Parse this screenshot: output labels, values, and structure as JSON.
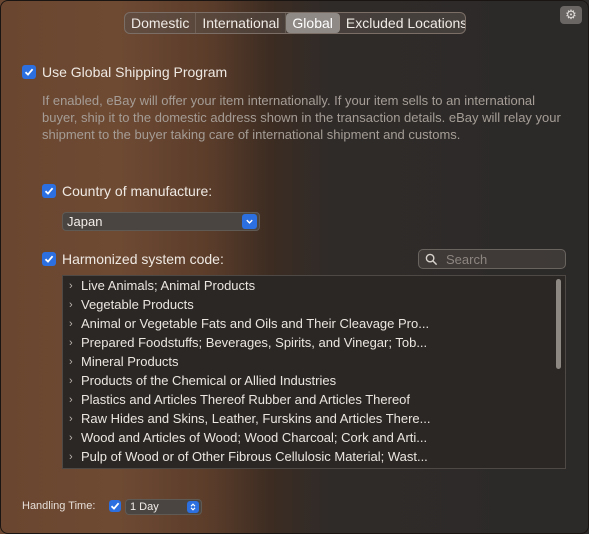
{
  "tabs": [
    "Domestic",
    "International",
    "Global",
    "Excluded Locations"
  ],
  "active_tab": "Global",
  "gear_icon": "gear-icon",
  "global_shipping": {
    "label": "Use Global Shipping Program",
    "checked": true,
    "description": "If enabled, eBay will offer your item internationally. If your item sells to an international buyer, ship it to the domestic address shown in the transaction details. eBay will relay your shipment to the buyer taking care of international shipment and customs."
  },
  "country": {
    "label": "Country of manufacture:",
    "checked": true,
    "value": "Japan"
  },
  "hs_code": {
    "label": "Harmonized system code:",
    "checked": true,
    "search_placeholder": "Search",
    "items": [
      "Live Animals; Animal Products",
      "Vegetable Products",
      "Animal or Vegetable Fats and Oils and Their Cleavage Pro...",
      "Prepared Foodstuffs; Beverages, Spirits, and Vinegar; Tob...",
      "Mineral Products",
      "Products of the Chemical or Allied Industries",
      "Plastics and Articles Thereof Rubber and Articles Thereof",
      "Raw Hides and Skins, Leather, Furskins and Articles There...",
      "Wood and Articles of Wood; Wood Charcoal; Cork and Arti...",
      "Pulp of Wood or of Other Fibrous Cellulosic Material; Wast..."
    ]
  },
  "handling": {
    "label": "Handling Time:",
    "checked": true,
    "value": "1 Day"
  },
  "colors": {
    "accent": "#2b6fe0"
  }
}
